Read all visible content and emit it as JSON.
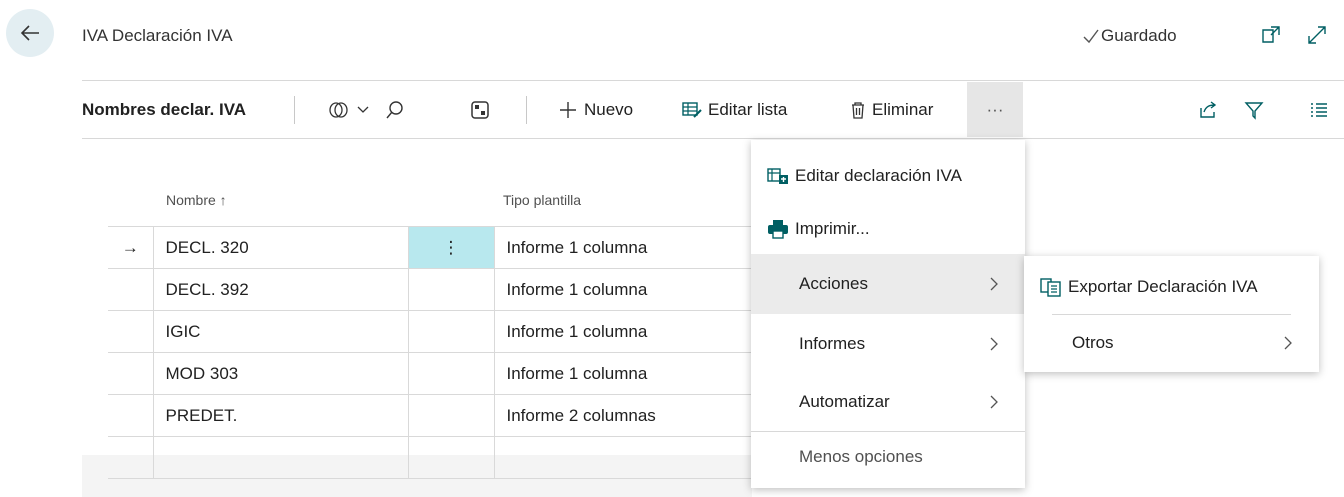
{
  "header": {
    "title": "IVA Declaración IVA",
    "saved_label": "Guardado"
  },
  "toolbar": {
    "page_name": "Nombres declar. IVA",
    "new_label": "Nuevo",
    "edit_list_label": "Editar lista",
    "delete_label": "Eliminar",
    "more_label": "···"
  },
  "grid": {
    "columns": [
      "Nombre ↑",
      "Tipo plantilla"
    ],
    "rows": [
      {
        "name": "DECL. 320",
        "template": "Informe 1 columna",
        "selected": true
      },
      {
        "name": "DECL. 392",
        "template": "Informe 1 columna"
      },
      {
        "name": "IGIC",
        "template": "Informe 1 columna"
      },
      {
        "name": "MOD 303",
        "template": "Informe 1 columna"
      },
      {
        "name": "PREDET.",
        "template": "Informe 2 columnas"
      }
    ],
    "row_selector_glyph": "→",
    "row_menu_glyph": "⋮"
  },
  "more_menu": {
    "items": [
      {
        "label": "Editar declaración IVA",
        "icon": "edit-statement-icon"
      },
      {
        "label": "Imprimir...",
        "icon": "printer-icon"
      },
      {
        "label": "Acciones",
        "submenu": true,
        "highlighted": true
      },
      {
        "label": "Informes",
        "submenu": true
      },
      {
        "label": "Automatizar",
        "submenu": true
      }
    ],
    "less_options_label": "Menos opciones"
  },
  "sub_menu": {
    "items": [
      {
        "label": "Exportar Declaración IVA",
        "icon": "export-icon"
      },
      {
        "label": "Otros",
        "submenu": true
      }
    ]
  },
  "colors": {
    "accent": "#008489",
    "selected_cell": "#b8e8ee",
    "back_button_bg": "#e3eef2"
  }
}
